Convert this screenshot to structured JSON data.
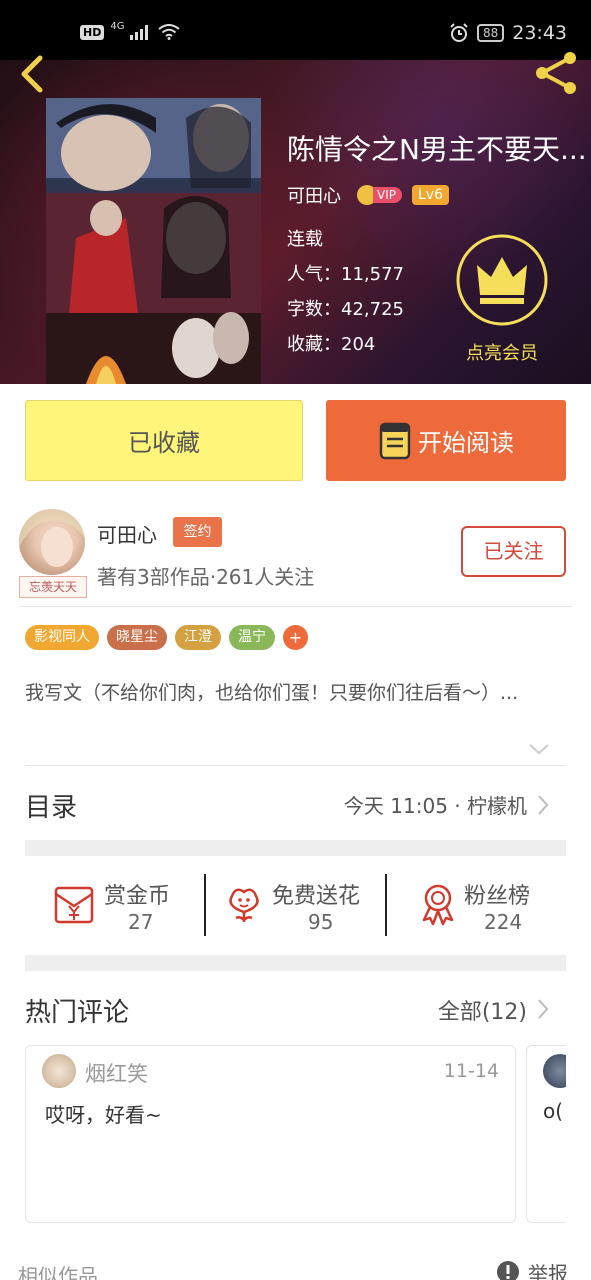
{
  "status_bar": {
    "hd": "HD",
    "network": "4G",
    "battery": "88",
    "time": "23:43",
    "icons": [
      "signal-icon",
      "wifi-icon",
      "alarm-icon",
      "battery-icon"
    ]
  },
  "header": {
    "back_icon": "back-chevron-icon",
    "share_icon": "share-icon",
    "title": "陈情令之N男主不要天...",
    "author": "可田心",
    "vip_label": "VIP",
    "level": "Lv6",
    "status": "连载",
    "popularity": "人气：11,577",
    "words": "字数：42,725",
    "collections": "收藏：204",
    "member_label": "点亮会员",
    "colors": {
      "member_gold": "#f5df5a",
      "lv_badge": "#f2a830",
      "vip_badge": "#e8506a"
    }
  },
  "actions": {
    "collected_label": "已收藏",
    "read_label": "开始阅读",
    "colors": {
      "collected_bg": "#fef57a",
      "read_bg": "#ef6a3a"
    }
  },
  "author_card": {
    "name": "可田心",
    "sign_badge": "签约",
    "avatar_tag": "忘羡天天",
    "meta": "著有3部作品·261人关注",
    "follow_label": "已关注",
    "accent": "#d24a3a"
  },
  "tags": [
    {
      "label": "影视同人",
      "color": "#f2a830"
    },
    {
      "label": "晓星尘",
      "color": "#c9704a"
    },
    {
      "label": "江澄",
      "color": "#d4a040"
    },
    {
      "label": "温宁",
      "color": "#8ab858"
    }
  ],
  "tags_more": "+",
  "description": "我写文（不给你们肉，也给你们蛋！只要你们往后看～）...",
  "toc": {
    "title": "目录",
    "update": "今天 11:05 · 柠檬机"
  },
  "rewards": [
    {
      "label": "赏金币",
      "count": "27",
      "icon": "red-envelope-icon"
    },
    {
      "label": "免费送花",
      "count": "95",
      "icon": "flower-icon"
    },
    {
      "label": "粉丝榜",
      "count": "224",
      "icon": "medal-icon"
    }
  ],
  "comments": {
    "title": "热门评论",
    "all_label": "全部(12)",
    "items": [
      {
        "user": "烟红笑",
        "date": "11-14",
        "text": "哎呀，好看~"
      },
      {
        "text": "o("
      }
    ]
  },
  "footer": {
    "similar": "相似作品",
    "report": "举报"
  }
}
